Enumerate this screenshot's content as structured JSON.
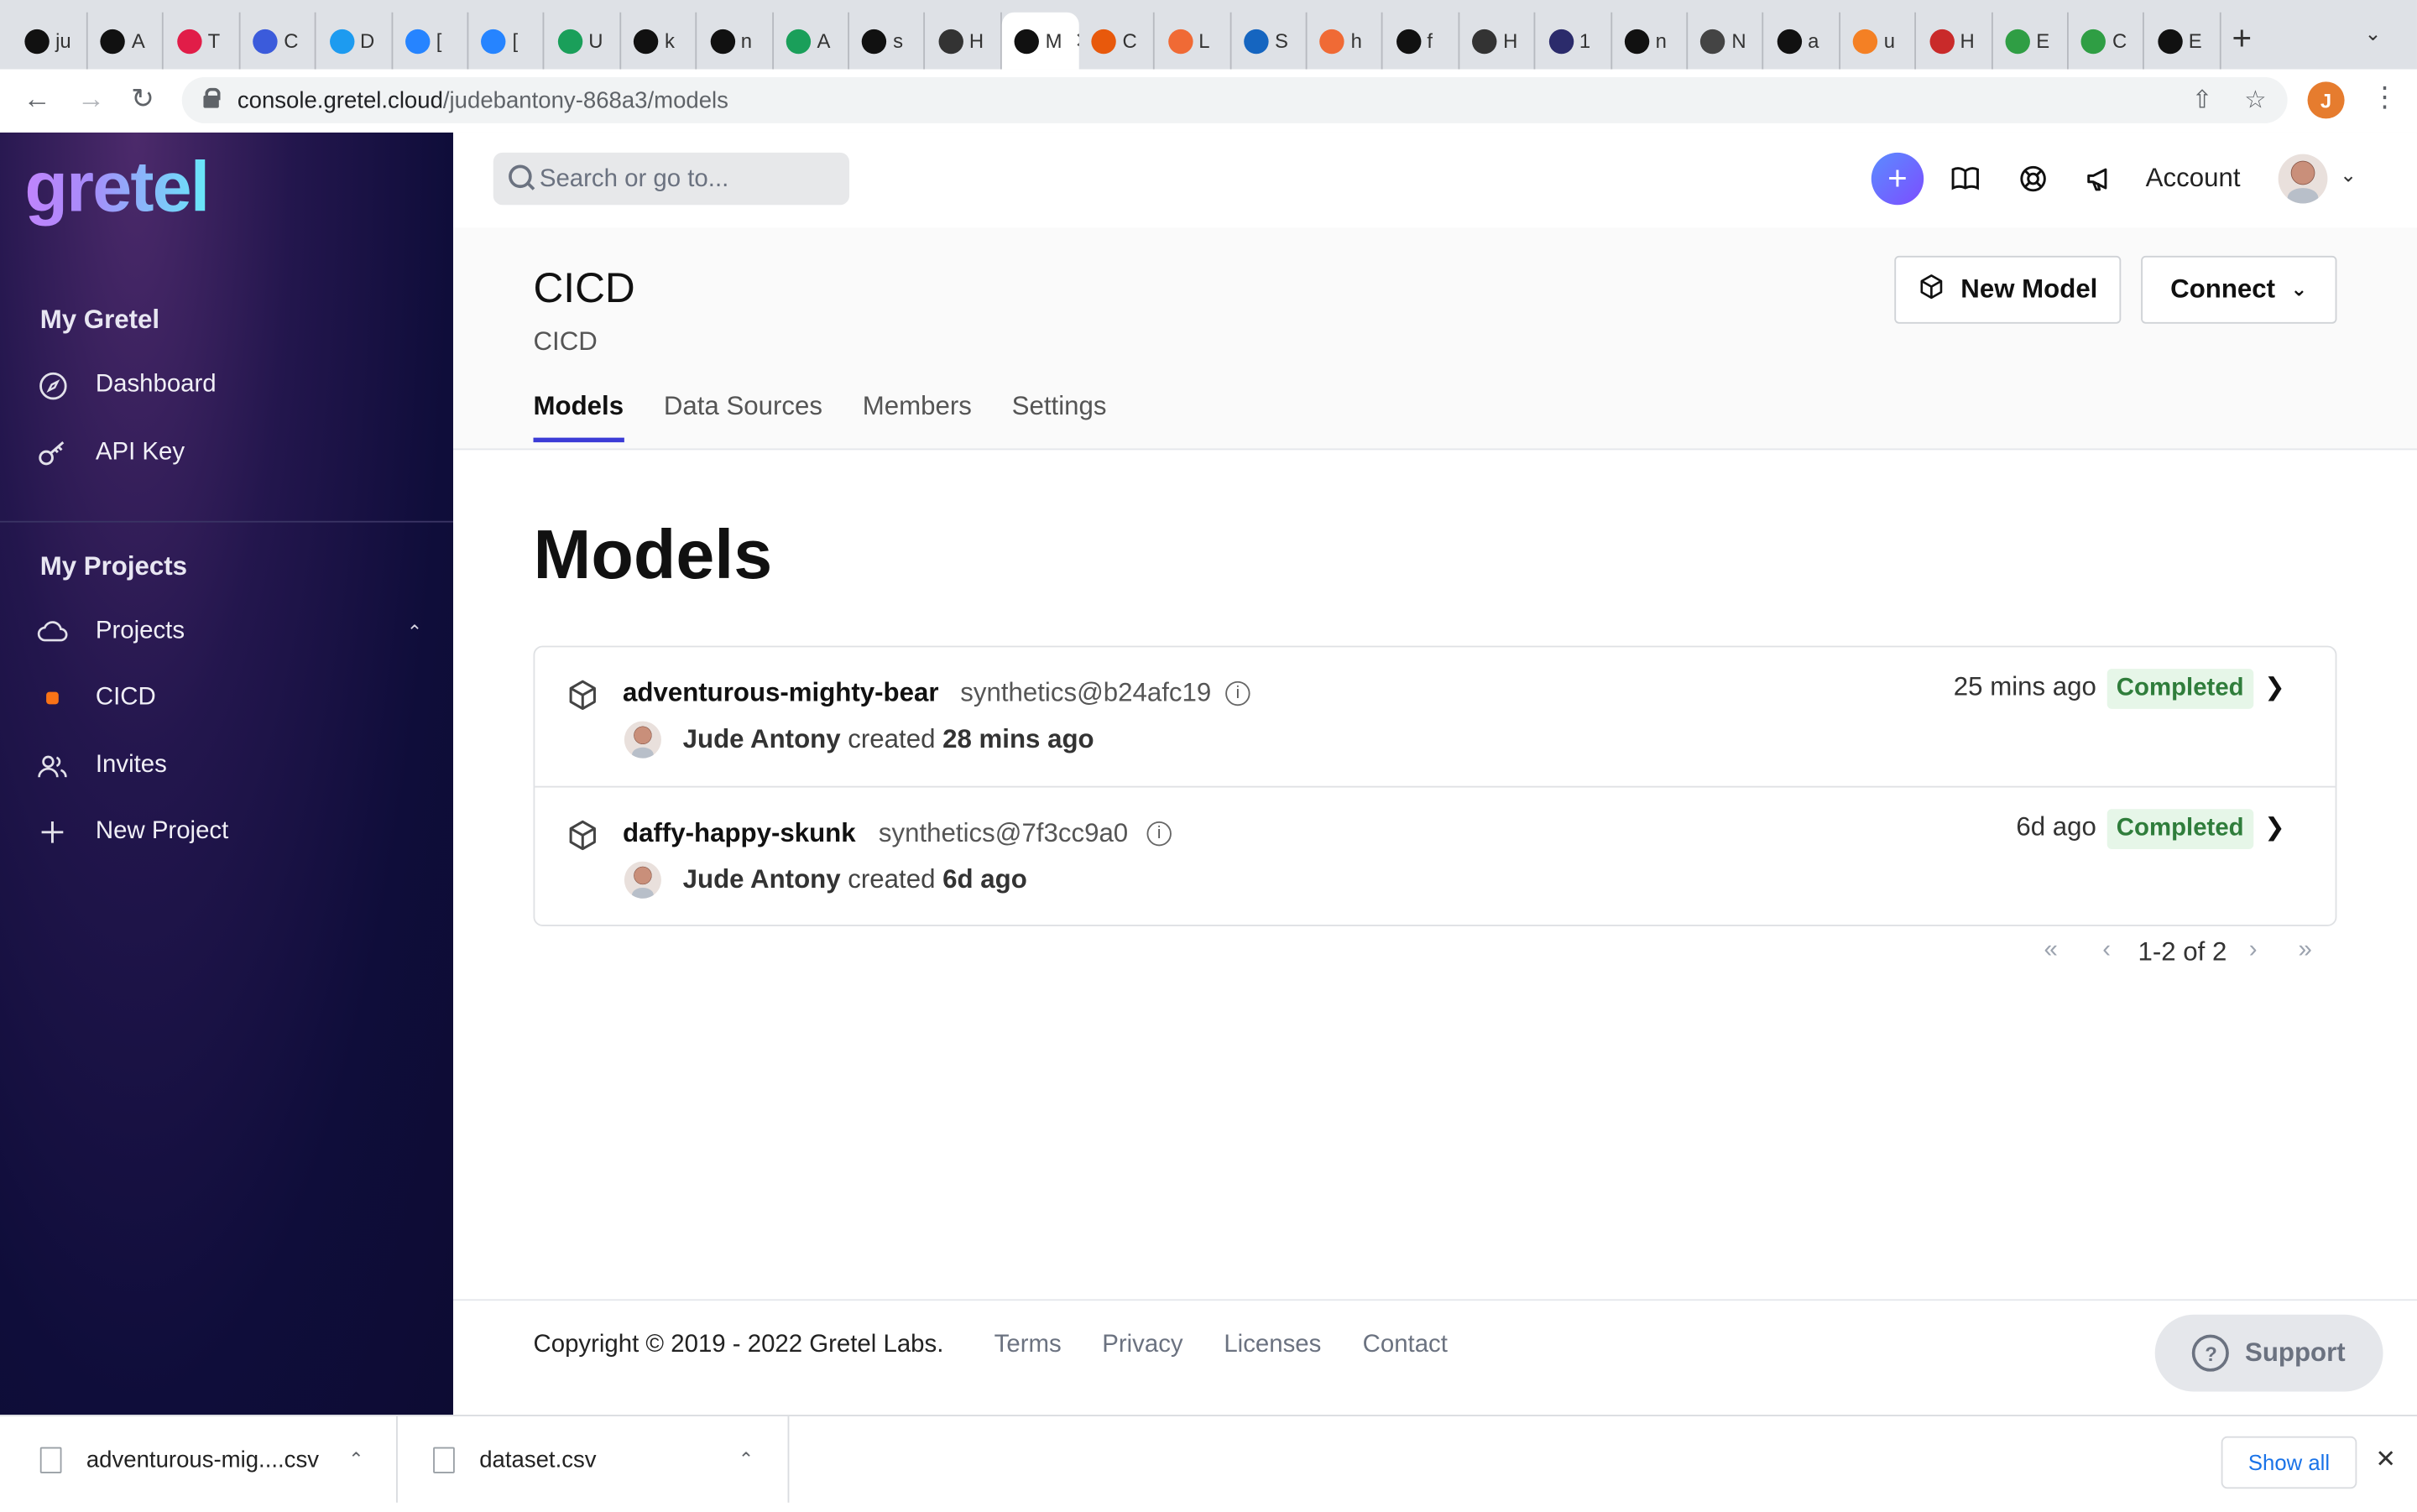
{
  "browser": {
    "tabs": [
      {
        "icon": "github-icon",
        "text": "ju",
        "color": "#111111"
      },
      {
        "icon": "github-icon",
        "text": "A",
        "color": "#111111"
      },
      {
        "icon": "tickticktype-icon",
        "text": "T",
        "color": "#e11d48"
      },
      {
        "icon": "hex-icon",
        "text": "C",
        "color": "#3b5bdb"
      },
      {
        "icon": "translate-icon",
        "text": "D",
        "color": "#1d9bf0"
      },
      {
        "icon": "jira-icon",
        "text": "[",
        "color": "#2684ff"
      },
      {
        "icon": "jira-icon",
        "text": "[",
        "color": "#2684ff"
      },
      {
        "icon": "kaggle-icon",
        "text": "U",
        "color": "#1a9f5a"
      },
      {
        "icon": "github-icon",
        "text": "k",
        "color": "#111111"
      },
      {
        "icon": "github-icon",
        "text": "n",
        "color": "#111111"
      },
      {
        "icon": "kaggle-icon",
        "text": "A",
        "color": "#1a9f5a"
      },
      {
        "icon": "github-icon",
        "text": "s",
        "color": "#111111"
      },
      {
        "icon": "gear-icon",
        "text": "H",
        "color": "#333333"
      },
      {
        "icon": "gretel-icon",
        "text": "M",
        "color": "#111111",
        "active": true
      },
      {
        "icon": "ring-icon",
        "text": "C",
        "color": "#e8590c"
      },
      {
        "icon": "leaf-icon",
        "text": "L",
        "color": "#f06a35"
      },
      {
        "icon": "k-icon",
        "text": "S",
        "color": "#1565c0"
      },
      {
        "icon": "leaf-icon",
        "text": "h",
        "color": "#f06a35"
      },
      {
        "icon": "github-icon",
        "text": "f",
        "color": "#111111"
      },
      {
        "icon": "gear-icon",
        "text": "H",
        "color": "#333333"
      },
      {
        "icon": "bird-icon",
        "text": "1",
        "color": "#2b2b6b"
      },
      {
        "icon": "github-icon",
        "text": "n",
        "color": "#111111"
      },
      {
        "icon": "chrome-icon",
        "text": "N",
        "color": "#444444"
      },
      {
        "icon": "github-icon",
        "text": "a",
        "color": "#111111"
      },
      {
        "icon": "stack-icon",
        "text": "u",
        "color": "#f48024"
      },
      {
        "icon": "doc-icon",
        "text": "H",
        "color": "#c92a2a"
      },
      {
        "icon": "frog-icon",
        "text": "E",
        "color": "#2f9e44"
      },
      {
        "icon": "frog-icon",
        "text": "C",
        "color": "#2f9e44"
      },
      {
        "icon": "github-icon",
        "text": "E",
        "color": "#111111"
      }
    ],
    "url_host": "console.gretel.cloud",
    "url_path": "/judebantony-868a3/models",
    "profile_initial": "J"
  },
  "sidebar": {
    "logo": "gretel",
    "section_my_gretel": "My Gretel",
    "dashboard": "Dashboard",
    "api_key": "API Key",
    "section_my_projects": "My Projects",
    "projects": "Projects",
    "project_cicd": "CICD",
    "invites": "Invites",
    "new_project": "New Project",
    "accent": "#f97316"
  },
  "header": {
    "search_placeholder": "Search or go to...",
    "account": "Account"
  },
  "project": {
    "title": "CICD",
    "subtitle": "CICD",
    "tabs": [
      "Models",
      "Data Sources",
      "Members",
      "Settings"
    ],
    "new_model": "New Model",
    "connect": "Connect"
  },
  "main": {
    "title": "Models",
    "models": [
      {
        "name": "adventurous-mighty-bear",
        "type": "synthetics@b24afc19",
        "author": "Jude Antony",
        "created_word": "created",
        "created": "28 mins ago",
        "updated": "25 mins ago",
        "status": "Completed"
      },
      {
        "name": "daffy-happy-skunk",
        "type": "synthetics@7f3cc9a0",
        "author": "Jude Antony",
        "created_word": "created",
        "created": "6d ago",
        "updated": "6d ago",
        "status": "Completed"
      }
    ],
    "pagination": "1-2 of 2"
  },
  "footer": {
    "copyright": "Copyright © 2019 - 2022 Gretel Labs.",
    "terms": "Terms",
    "privacy": "Privacy",
    "licenses": "Licenses",
    "contact": "Contact",
    "support": "Support"
  },
  "downloads": {
    "files": [
      "adventurous-mig....csv",
      "dataset.csv"
    ],
    "show_all": "Show all"
  }
}
